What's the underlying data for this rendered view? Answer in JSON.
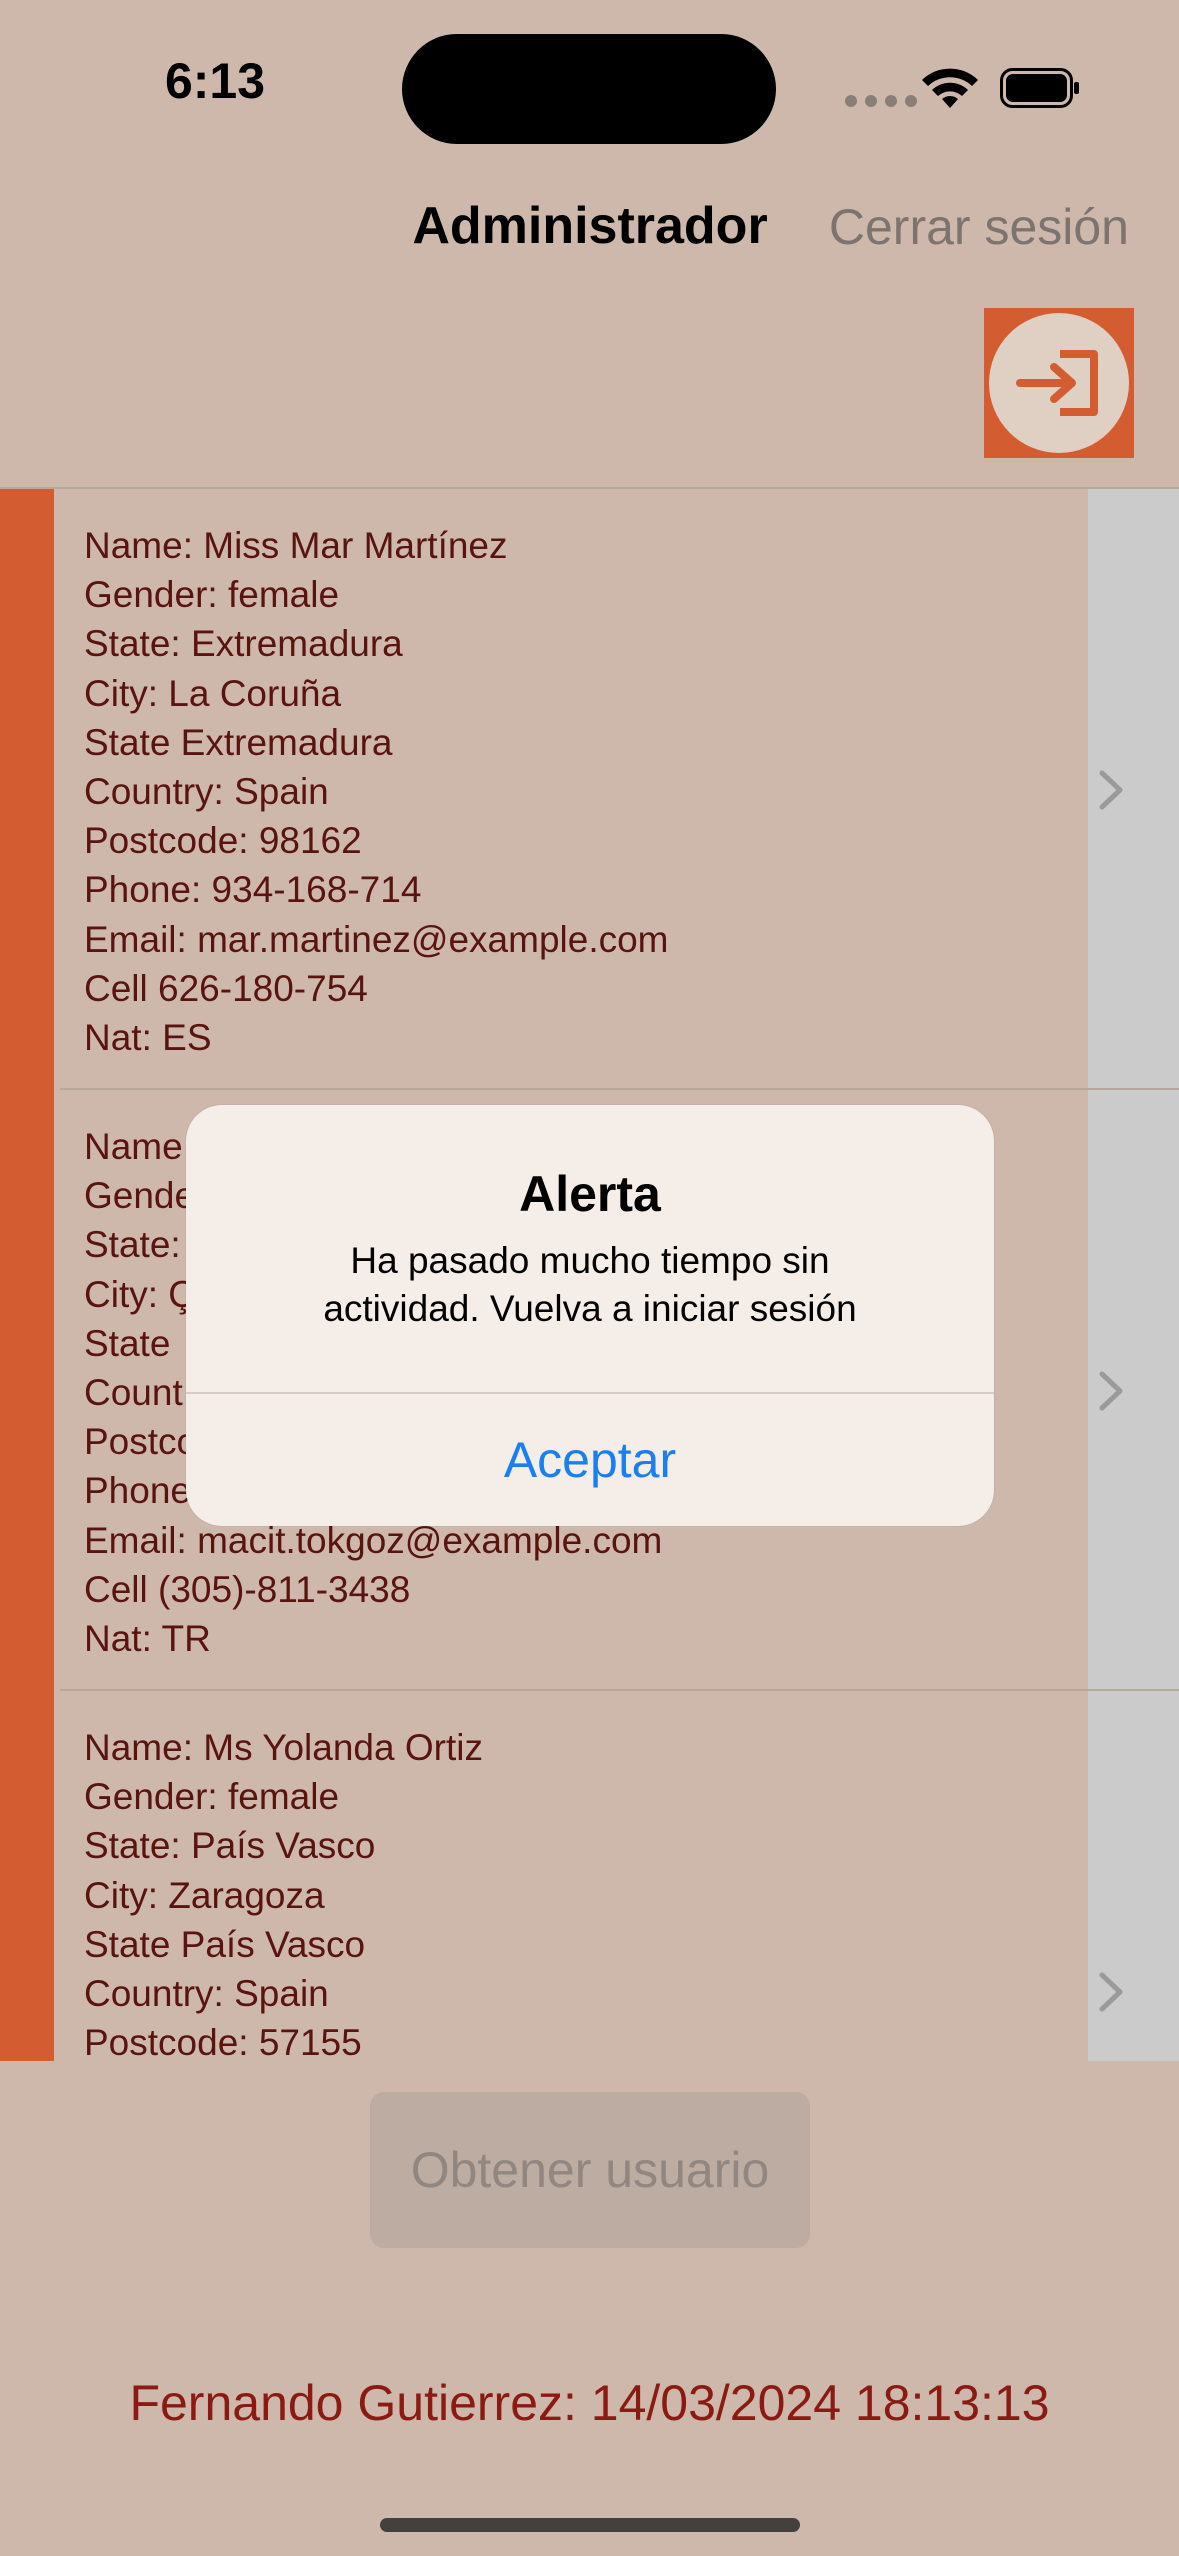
{
  "status_bar": {
    "time": "6:13"
  },
  "header": {
    "title": "Administrador",
    "logout_label": "Cerrar sesión"
  },
  "users": [
    {
      "lines": [
        "Name: Miss Mar Martínez",
        "Gender: female",
        "State: Extremadura",
        "City: La Coruña",
        "State Extremadura",
        "Country: Spain",
        "Postcode: 98162",
        "Phone: 934-168-714",
        "Email: mar.martinez@example.com",
        "Cell 626-180-754",
        "Nat: ES"
      ]
    },
    {
      "lines": [
        "Name:",
        "Gende",
        "State:",
        "City: Ç",
        "State",
        "Count",
        "Postco",
        "Phone",
        "Email: macit.tokgoz@example.com",
        "Cell (305)-811-3438",
        "Nat: TR"
      ]
    },
    {
      "lines": [
        "Name: Ms Yolanda Ortiz",
        "Gender: female",
        "State: País Vasco",
        "City: Zaragoza",
        "State País Vasco",
        "Country: Spain",
        "Postcode: 57155"
      ]
    }
  ],
  "get_user_button": "Obtener usuario",
  "footer": "Fernando Gutierrez: 14/03/2024 18:13:13",
  "alert": {
    "title": "Alerta",
    "message": "Ha pasado mucho tiempo sin actividad. Vuelva a iniciar sesión",
    "button": "Aceptar"
  },
  "colors": {
    "background": "#cdb8ab",
    "accent": "#d35c30",
    "text_dark_red": "#5a1410",
    "footer_red": "#8a1a12",
    "alert_link": "#1a7ff0"
  }
}
